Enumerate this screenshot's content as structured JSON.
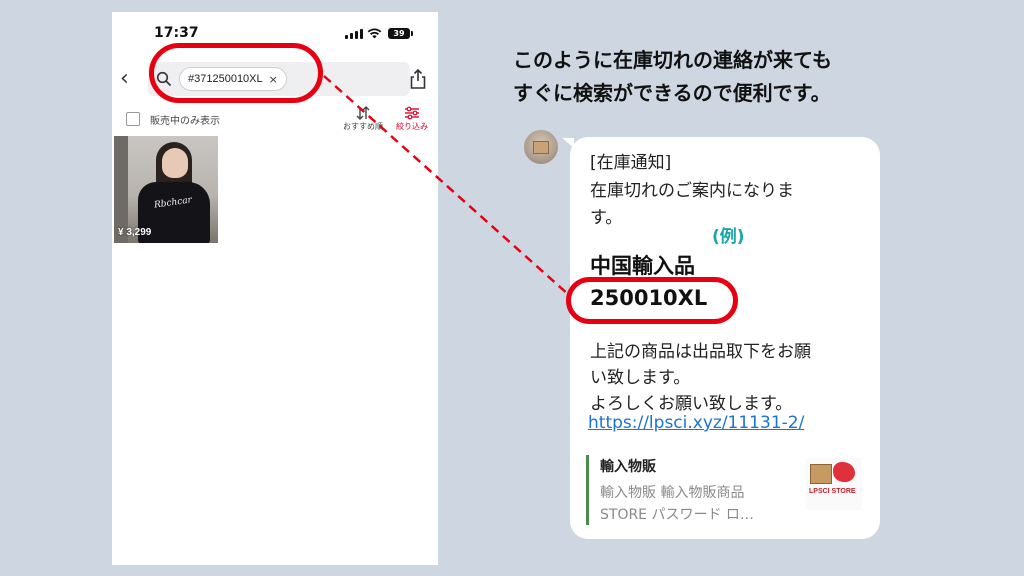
{
  "phone": {
    "status": {
      "time": "17:37",
      "battery": "39"
    },
    "search": {
      "tag": "#371250010XL",
      "tag_close": "×"
    },
    "back_glyph": "‹",
    "filters": {
      "checkbox_label": "販売中のみ表示",
      "sort_label": "おすすめ順",
      "filter_label": "絞り込み"
    },
    "product": {
      "price": "¥ 3,299",
      "print": "Rbchcar"
    }
  },
  "caption": {
    "line1": "このように在庫切れの連絡が来ても",
    "line2": "すぐに検索ができるので便利です。"
  },
  "message": {
    "header": "[在庫通知]",
    "body_line1": "在庫切れのご案内になりま",
    "body_line2": "す。",
    "example_label": "(例)",
    "product_title": "中国輸入品",
    "product_code": "250010XL",
    "request_line1": "上記の商品は出品取下をお願",
    "request_line2": "い致します。",
    "request_line3": "よろしくお願い致します。",
    "link": "https://lpsci.xyz/11131-2/"
  },
  "link_preview": {
    "title": "輸入物販",
    "desc_line1": "輸入物販 輸入物販商品",
    "desc_line2": "STORE パスワード ロ…",
    "logo_text": "LPSCI STORE"
  },
  "colors": {
    "highlight": "#e60012",
    "example_label": "#1aa6a6",
    "link": "#1a73d9",
    "background": "#cdd6e1"
  }
}
